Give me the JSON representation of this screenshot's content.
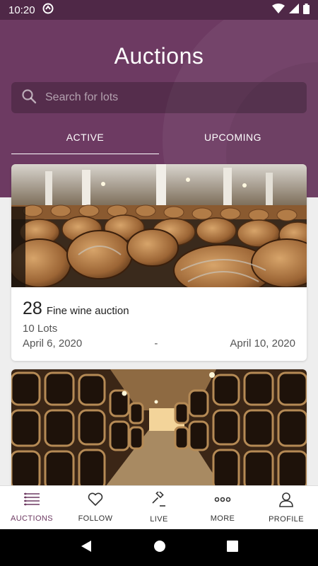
{
  "status_bar": {
    "time": "10:20"
  },
  "header": {
    "title": "Auctions",
    "search_placeholder": "Search for lots",
    "tabs": [
      {
        "label": "ACTIVE",
        "active": true
      },
      {
        "label": "UPCOMING",
        "active": false
      }
    ]
  },
  "auctions": [
    {
      "number": "28",
      "name": "Fine wine auction",
      "lots": "10 Lots",
      "start_date": "April 6, 2020",
      "separator": "-",
      "end_date": "April 10, 2020",
      "image": "wine-barrel-cellar-photo"
    },
    {
      "image": "bottle-cellar-corridor-photo"
    }
  ],
  "bottom_nav": [
    {
      "label": "AUCTIONS",
      "icon": "list-icon",
      "active": true
    },
    {
      "label": "FOLLOW",
      "icon": "heart-icon",
      "active": false
    },
    {
      "label": "LIVE",
      "icon": "gavel-icon",
      "active": false
    },
    {
      "label": "MORE",
      "icon": "more-icon",
      "active": false
    },
    {
      "label": "PROFILE",
      "icon": "user-icon",
      "active": false
    }
  ],
  "colors": {
    "brand": "#6d3a62",
    "status_bar": "#4f2847"
  }
}
